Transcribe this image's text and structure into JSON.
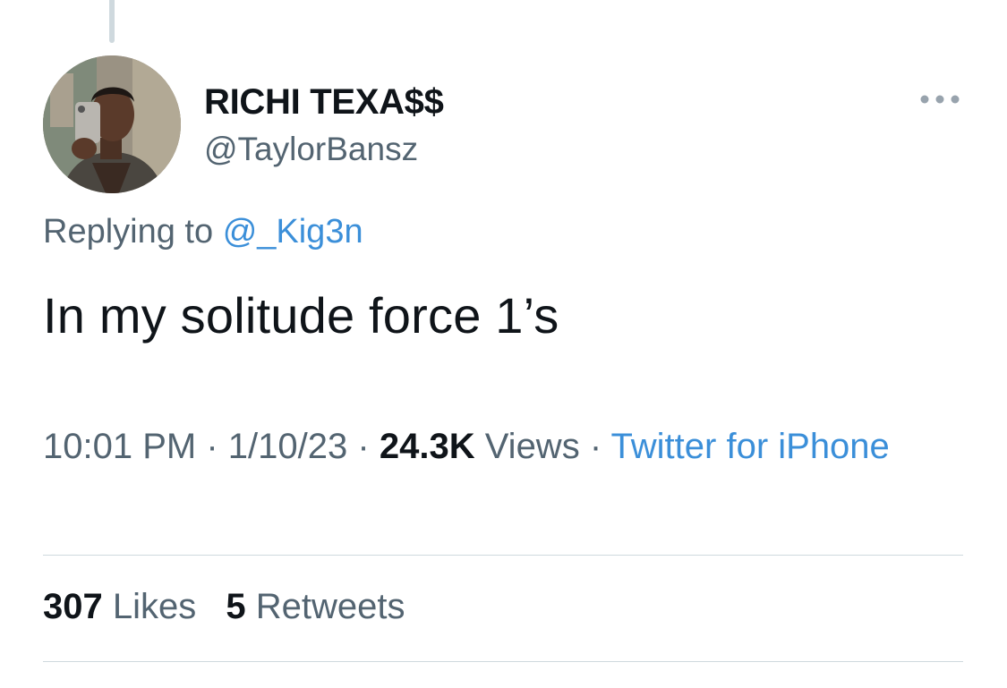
{
  "tweet": {
    "author": {
      "display_name": "RICHI TEXA$$",
      "handle": "@TaylorBansz"
    },
    "replying_prefix": "Replying to",
    "replying_to": "@_Kig3n",
    "text": "In my solitude force 1’s",
    "time": "10:01 PM",
    "separator": "·",
    "date": "1/10/23",
    "views_count": "24.3K",
    "views_label": "Views",
    "source": "Twitter for iPhone",
    "likes_count": "307",
    "likes_label": "Likes",
    "retweets_count": "5",
    "retweets_label": "Retweets"
  },
  "colors": {
    "primary_text": "#0f1419",
    "secondary_text": "#536471",
    "link": "#3b8fd9",
    "divider": "#cfd9de"
  },
  "icons": {
    "more": "more-horizontal-icon"
  }
}
